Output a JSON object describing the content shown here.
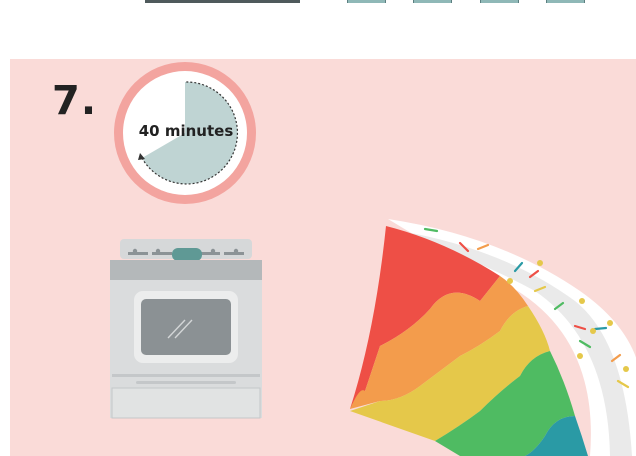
{
  "step": {
    "number": "7."
  },
  "timer": {
    "label": "40 minutes",
    "icon": "timer-icon",
    "fraction_filled": 0.67
  },
  "illustrations": {
    "oven": "oven-icon",
    "cake": "rainbow-cake-slice-icon"
  },
  "colors": {
    "background": "#fadbd8",
    "timer_ring": "#f3a49f",
    "timer_fill": "#bfd4d3",
    "oven_body": "#dadcdd",
    "oven_window": "#8b9194",
    "cake_red": "#ee4f46",
    "cake_orange": "#f39c4c",
    "cake_yellow": "#e5c84a",
    "cake_green": "#4fbb62",
    "cake_blue": "#2a9aa5"
  }
}
